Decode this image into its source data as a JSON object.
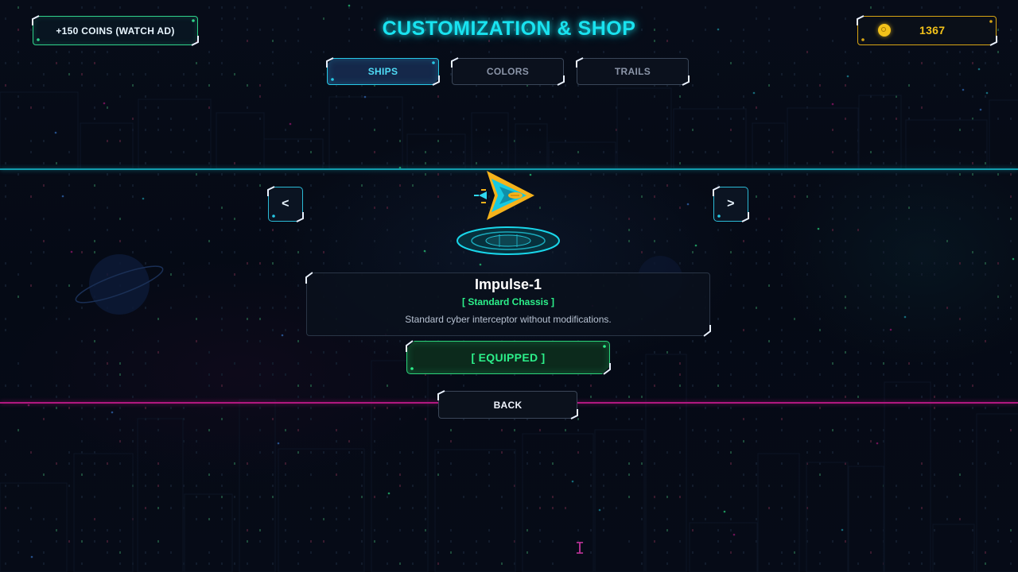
{
  "header": {
    "title": "CUSTOMIZATION & SHOP",
    "ad_button_label": "+150 COINS (WATCH AD)",
    "coin_count": "1367",
    "coin_icon": "coin-icon"
  },
  "tabs": [
    {
      "label": "SHIPS",
      "active": true
    },
    {
      "label": "COLORS",
      "active": false
    },
    {
      "label": "TRAILS",
      "active": false
    }
  ],
  "carousel": {
    "prev_label": "<",
    "next_label": ">",
    "ship_icon": "spaceship-icon",
    "pedestal_icon": "hologram-pedestal-icon"
  },
  "ship": {
    "name": "Impulse-1",
    "class": "[ Standard Chassis ]",
    "description": "Standard cyber interceptor without modifications."
  },
  "actions": {
    "equipped_label": "[ EQUIPPED ]",
    "back_label": "BACK"
  },
  "theme": {
    "accent_cyan": "#19e3f0",
    "accent_green": "#2cf08a",
    "accent_gold": "#f3c21a",
    "accent_magenta": "#b1187f"
  }
}
